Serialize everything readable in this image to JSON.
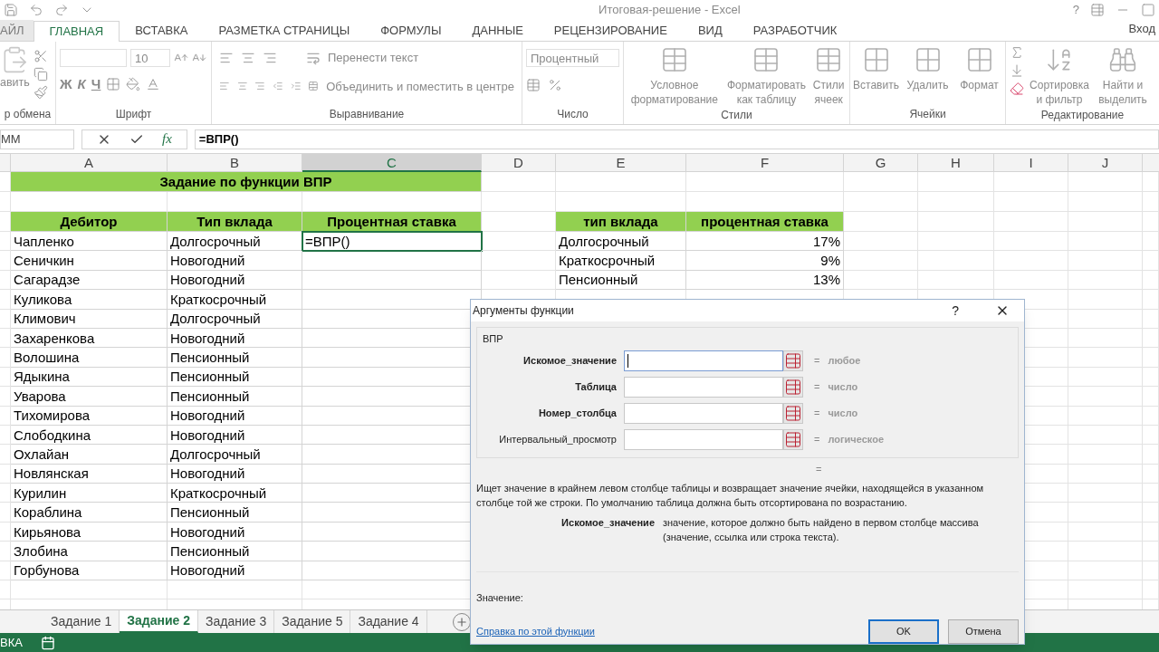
{
  "window": {
    "title": "Итоговая-решение - Excel",
    "help": "?",
    "sign_in": "Вход"
  },
  "ribbon_tabs": [
    {
      "label": "АЙЛ",
      "selected": false
    },
    {
      "label": "ГЛАВНАЯ",
      "selected": true
    },
    {
      "label": "ВСТАВКА",
      "selected": false
    },
    {
      "label": "РАЗМЕТКА СТРАНИЦЫ",
      "selected": false
    },
    {
      "label": "ФОРМУЛЫ",
      "selected": false
    },
    {
      "label": "ДАННЫЕ",
      "selected": false
    },
    {
      "label": "РЕЦЕНЗИРОВАНИЕ",
      "selected": false
    },
    {
      "label": "ВИД",
      "selected": false
    },
    {
      "label": "РАЗРАБОТЧИК",
      "selected": false
    }
  ],
  "ribbon": {
    "paste": "авить",
    "clipboard_group": "р обмена",
    "font_size": "10",
    "bold": "Ж",
    "italic": "К",
    "underline": "Ч",
    "font_group": "Шрифт",
    "wrap_text": "Перенести текст",
    "merge": "Объединить и поместить в центре",
    "alignment_group": "Выравнивание",
    "number_format": "Процентный",
    "number_group": "Число",
    "styles": [
      "Условное форматирование",
      "Форматировать как таблицу",
      "Стили ячеек"
    ],
    "styles_group": "Стили",
    "cells": [
      "Вставить",
      "Удалить",
      "Формат"
    ],
    "cells_group": "Ячейки",
    "editing": [
      "Сортировка и фильтр",
      "Найти и выделить"
    ],
    "editing_group": "Редактирование"
  },
  "formula_bar": {
    "name_box": "ММ",
    "fx": "fx",
    "formula": "=ВПР()"
  },
  "column_headers": [
    {
      "label": "A",
      "selected": false
    },
    {
      "label": "B",
      "selected": false
    },
    {
      "label": "C",
      "selected": true
    },
    {
      "label": "D",
      "selected": false
    },
    {
      "label": "E",
      "selected": false
    },
    {
      "label": "F",
      "selected": false
    },
    {
      "label": "G",
      "selected": false
    },
    {
      "label": "H",
      "selected": false
    },
    {
      "label": "I",
      "selected": false
    },
    {
      "label": "J",
      "selected": false
    }
  ],
  "sheet": {
    "title": "Задание по функции ВПР",
    "table": {
      "columns": [
        "Дебитор",
        "Тип вклада",
        "Процентная ставка"
      ],
      "rows": [
        {
          "name": "Чапленко",
          "type": "Долгосрочный",
          "rate": "=ВПР()",
          "selected": true
        },
        {
          "name": "Сеничкин",
          "type": "Новогодний",
          "selected": false
        },
        {
          "name": "Сагарадзе",
          "type": "Новогодний",
          "selected": false
        },
        {
          "name": "Куликова",
          "type": "Краткосрочный",
          "selected": false
        },
        {
          "name": "Климович",
          "type": "Долгосрочный",
          "selected": false
        },
        {
          "name": "Захаренкова",
          "type": "Новогодний",
          "selected": false
        },
        {
          "name": "Волошина",
          "type": "Пенсионный",
          "selected": false
        },
        {
          "name": "Ядыкина",
          "type": "Пенсионный",
          "selected": false
        },
        {
          "name": "Уварова",
          "type": "Пенсионный",
          "selected": false
        },
        {
          "name": "Тихомирова",
          "type": "Новогодний",
          "selected": false
        },
        {
          "name": "Слободкина",
          "type": "Новогодний",
          "selected": false
        },
        {
          "name": "Охлайан",
          "type": "Долгосрочный",
          "selected": false
        },
        {
          "name": "Новлянская",
          "type": "Новогодний",
          "selected": false
        },
        {
          "name": "Курилин",
          "type": "Краткосрочный",
          "selected": false
        },
        {
          "name": "Кораблина",
          "type": "Пенсионный",
          "selected": false
        },
        {
          "name": "Кирьянова",
          "type": "Новогодний",
          "selected": false
        },
        {
          "name": "Злобина",
          "type": "Пенсионный",
          "selected": false
        },
        {
          "name": "Горбунова",
          "type": "Новогодний",
          "selected": false
        }
      ]
    },
    "lookup": {
      "columns": [
        "тип вклада",
        "процентная ставка"
      ],
      "rows": [
        [
          "Долгосрочный",
          "17%"
        ],
        [
          "Краткосрочный",
          "9%"
        ],
        [
          "Пенсионный",
          "13%"
        ]
      ]
    }
  },
  "dialog": {
    "title": "Аргументы функции",
    "help": "?",
    "function": "ВПР",
    "arguments": [
      {
        "label": "Искомое_значение",
        "required": true,
        "focused": true,
        "result": "любое"
      },
      {
        "label": "Таблица",
        "required": true,
        "focused": false,
        "result": "число"
      },
      {
        "label": "Номер_столбца",
        "required": true,
        "focused": false,
        "result": "число"
      },
      {
        "label": "Интервальный_просмотр",
        "required": false,
        "focused": false,
        "result": "логическое"
      }
    ],
    "equals": "=",
    "result_equals": "=",
    "description": "Ищет значение в крайнем левом столбце таблицы и возвращает значение ячейки, находящейся в указанном столбце той же строки. По умолчанию таблица должна быть отсортирована по возрастанию.",
    "arg_help": {
      "name": "Искомое_значение",
      "text": "значение, которое должно быть найдено в первом столбце массива (значение, ссылка или строка текста)."
    },
    "value_label": "Значение:",
    "help_link": "Справка по этой функции",
    "buttons": [
      {
        "label": "OK",
        "default": true
      },
      {
        "label": "Отмена",
        "default": false
      }
    ]
  },
  "sheet_tabs": [
    {
      "label": "Задание 1",
      "selected": false
    },
    {
      "label": "Задание 2",
      "selected": true
    },
    {
      "label": "Задание 3",
      "selected": false
    },
    {
      "label": "Задание 5",
      "selected": false
    },
    {
      "label": "Задание 4",
      "selected": false
    }
  ],
  "status_bar": {
    "mode": "ВКА"
  }
}
